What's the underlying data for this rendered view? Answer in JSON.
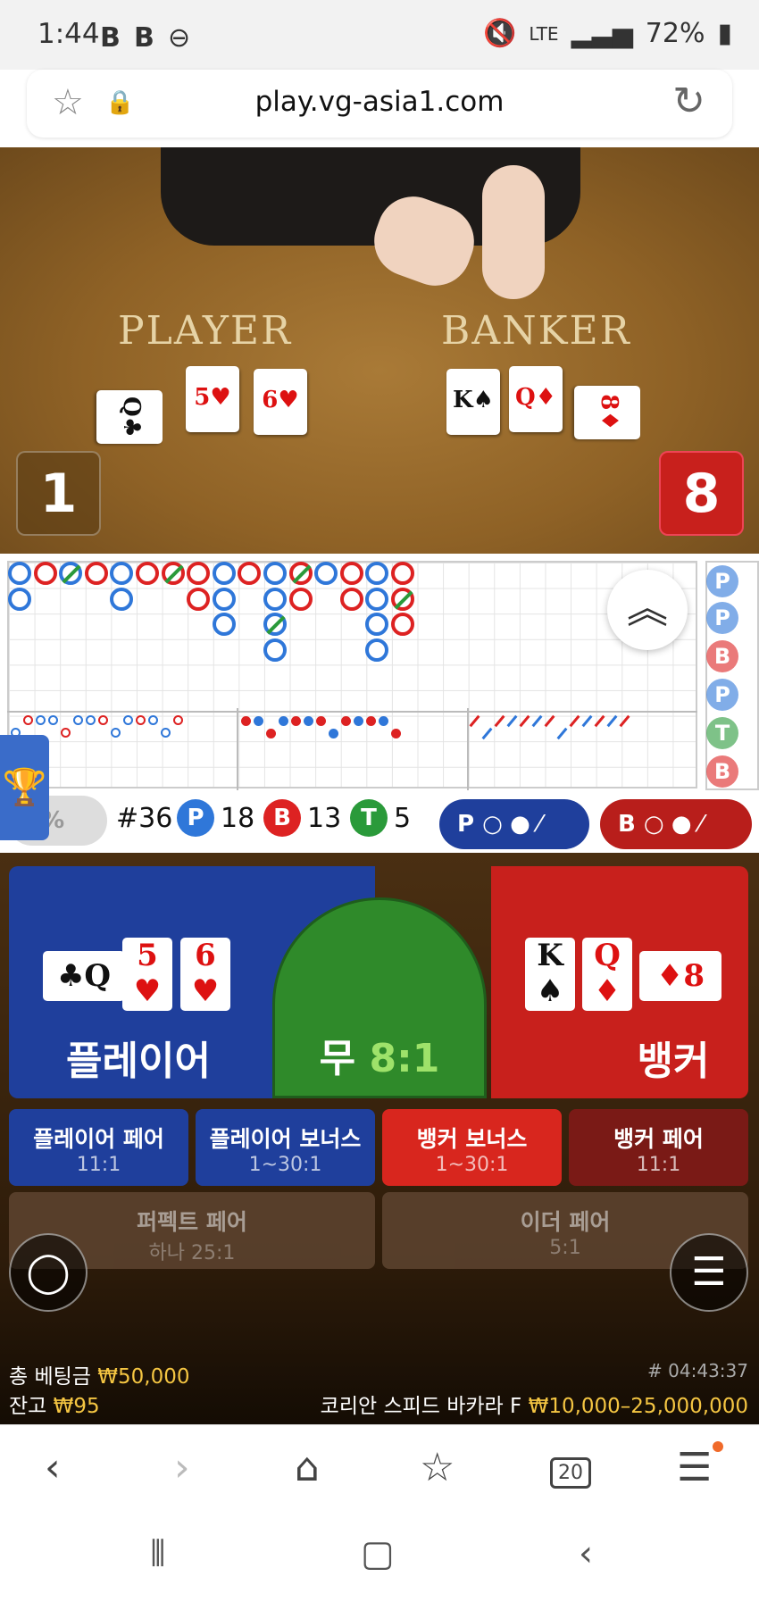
{
  "status_bar": {
    "time": "1:44",
    "app_icons": [
      "B",
      "B"
    ],
    "battery": "72%",
    "network": "LTE"
  },
  "browser": {
    "url": "play.vg-asia1.com"
  },
  "video": {
    "player_label": "PLAYER",
    "banker_label": "BANKER",
    "player_score": "1",
    "banker_score": "8",
    "player_cards": [
      {
        "rank": "Q",
        "suit": "♣",
        "color": "black"
      },
      {
        "rank": "5",
        "suit": "♥",
        "color": "red"
      },
      {
        "rank": "6",
        "suit": "♥",
        "color": "red"
      }
    ],
    "banker_cards": [
      {
        "rank": "K",
        "suit": "♠",
        "color": "black"
      },
      {
        "rank": "Q",
        "suit": "♦",
        "color": "red"
      },
      {
        "rank": "8",
        "suit": "♦",
        "color": "red"
      }
    ]
  },
  "roadmap": {
    "bead_columns": [
      [
        "P",
        "P"
      ],
      [
        "B"
      ],
      [
        "B"
      ]
    ],
    "prediction": [
      "P",
      "P",
      "B",
      "P",
      "T",
      "B"
    ]
  },
  "stats": {
    "progress": "0%",
    "round": "#36",
    "player_letter": "P",
    "player_count": "18",
    "banker_letter": "B",
    "banker_count": "13",
    "tie_letter": "T",
    "tie_count": "5",
    "player_pill": "P",
    "banker_pill": "B"
  },
  "table": {
    "player_name": "플레이어",
    "tie_name": "무",
    "tie_odds": "8:1",
    "banker_name": "뱅커",
    "player_cards": [
      {
        "rank": "♣",
        "suit": "Q",
        "color": "black"
      },
      {
        "rank": "5",
        "suit": "♥",
        "color": "red"
      },
      {
        "rank": "6",
        "suit": "♥",
        "color": "red"
      }
    ],
    "banker_cards": [
      {
        "rank": "K",
        "suit": "♠",
        "color": "black"
      },
      {
        "rank": "Q",
        "suit": "♦",
        "color": "red"
      },
      {
        "rank": "♦",
        "suit": "8",
        "color": "red"
      }
    ],
    "side_bets": [
      {
        "name": "플레이어 페어",
        "odds": "11:1"
      },
      {
        "name": "플레이어 보너스",
        "odds": "1~30:1"
      },
      {
        "name": "뱅커 보너스",
        "odds": "1~30:1"
      },
      {
        "name": "뱅커 페어",
        "odds": "11:1"
      },
      {
        "name": "퍼펙트 페어",
        "odds": "하나 25:1"
      },
      {
        "name": "이더 페어",
        "odds": "5:1"
      }
    ]
  },
  "footer": {
    "total_bet_label": "총 베팅금",
    "total_bet_value": "₩50,000",
    "balance_label": "잔고",
    "balance_value": "₩95",
    "round_id": "# 04:43:37",
    "table_name": "코리안 스피드 바카라 F",
    "limits": "₩10,000–25,000,000"
  },
  "browser_nav": {
    "tabs_count": "20"
  },
  "colors": {
    "player": "#1f3f9c",
    "banker": "#c8201c",
    "tie": "#2f8a2a"
  }
}
